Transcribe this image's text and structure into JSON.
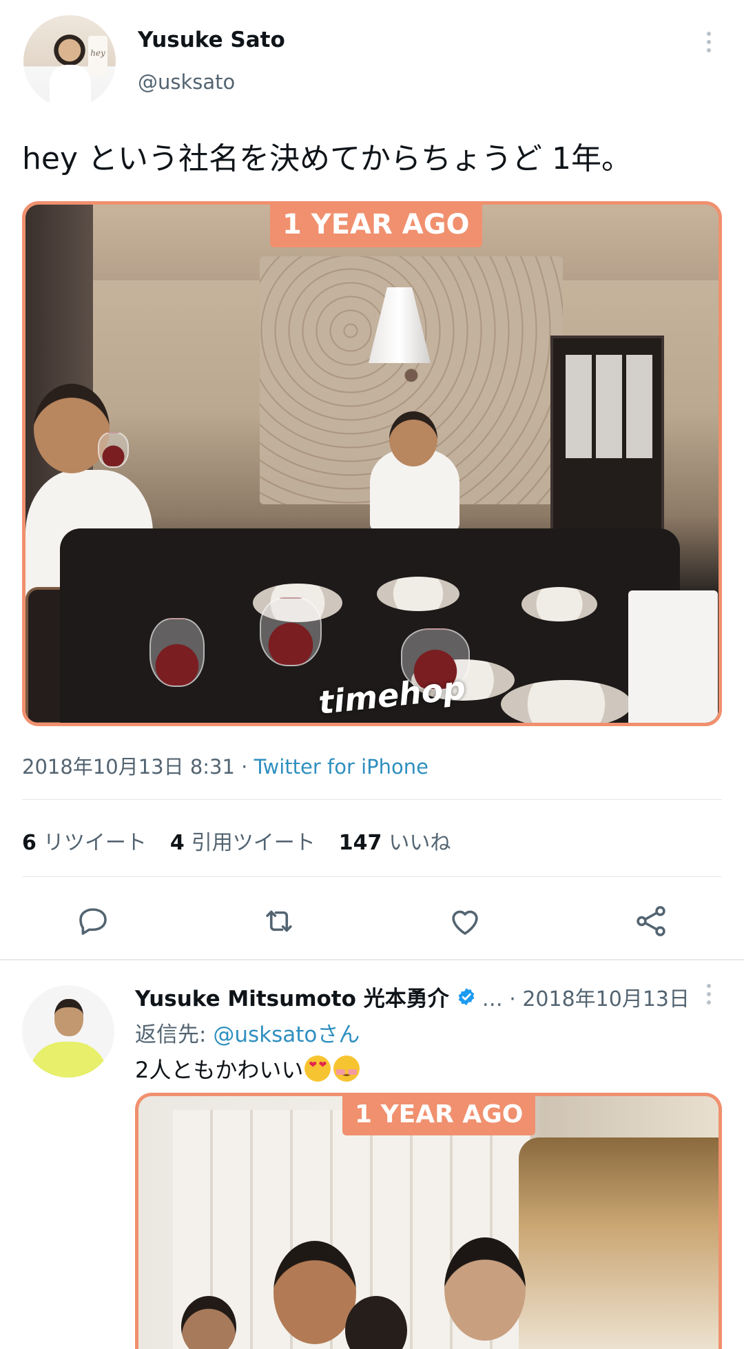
{
  "main_tweet": {
    "author_name": "Yusuke Sato",
    "author_handle": "@usksato",
    "avatar_sign_text": "hey",
    "text": "hey という社名を決めてからちょうど 1年。",
    "photo": {
      "overlay_badge": "1 YEAR AGO",
      "watermark": "timehop"
    },
    "timestamp": "2018年10月13日 8:31",
    "separator": " · ",
    "source": "Twitter for iPhone",
    "stats": {
      "retweets_count": "6",
      "retweets_label": "リツイート",
      "quotes_count": "4",
      "quotes_label": "引用ツイート",
      "likes_count": "147",
      "likes_label": "いいね"
    },
    "actions": [
      "reply-icon",
      "retweet-icon",
      "like-icon",
      "share-icon"
    ]
  },
  "reply_tweet": {
    "author_name": "Yusuke Mitsumoto 光本勇介",
    "verified": true,
    "meta_rest": "… · 2018年10月13日",
    "replying_to_label": "返信先: ",
    "replying_to_handle": "@usksatoさん",
    "text": "2人ともかわいい",
    "emojis": [
      "heart-eyes-emoji",
      "smiling-blush-emoji"
    ],
    "photo": {
      "overlay_badge": "1 YEAR AGO"
    }
  },
  "colors": {
    "text_primary": "#0f1419",
    "text_secondary": "#536471",
    "link": "#2f8fbf",
    "verified": "#1d9bf0",
    "photo_frame": "#f0906e"
  }
}
